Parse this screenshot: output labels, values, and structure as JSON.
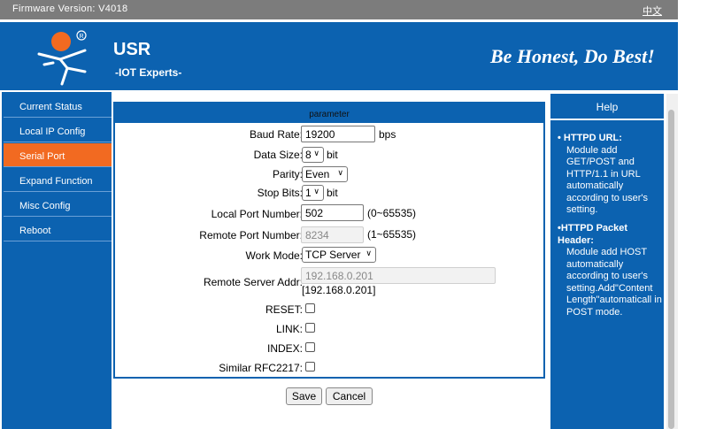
{
  "topbar": {
    "firmware": "Firmware Version:  V4018",
    "language": "中文"
  },
  "banner": {
    "brand": "USR",
    "subtitle": "-IOT Experts-",
    "slogan": "Be Honest, Do Best!"
  },
  "sidebar": {
    "items": [
      {
        "label": "Current Status"
      },
      {
        "label": "Local IP Config"
      },
      {
        "label": "Serial Port",
        "active": true
      },
      {
        "label": "Expand Function"
      },
      {
        "label": "Misc Config"
      },
      {
        "label": "Reboot"
      }
    ]
  },
  "form": {
    "section_title": "parameter",
    "baud_rate": {
      "label": "Baud Rate:",
      "value": "19200",
      "unit": "bps"
    },
    "data_size": {
      "label": "Data Size:",
      "value": "8",
      "unit": "bit"
    },
    "parity": {
      "label": "Parity:",
      "value": "Even"
    },
    "stop_bits": {
      "label": "Stop Bits:",
      "value": "1",
      "unit": "bit"
    },
    "local_port": {
      "label": "Local Port Number:",
      "value": "502",
      "range": "(0~65535)"
    },
    "remote_port": {
      "label": "Remote Port Number:",
      "value": "8234",
      "range": "(1~65535)"
    },
    "work_mode": {
      "label": "Work Mode:",
      "value": "TCP Server"
    },
    "remote_addr": {
      "label": "Remote Server Addr:",
      "value": "192.168.0.201",
      "note": "[192.168.0.201]"
    },
    "reset": {
      "label": "RESET:"
    },
    "link": {
      "label": "LINK:"
    },
    "index": {
      "label": "INDEX:"
    },
    "rfc2217": {
      "label": "Similar RFC2217:"
    },
    "save_label": "Save",
    "cancel_label": "Cancel"
  },
  "help": {
    "title": "Help",
    "items": [
      {
        "title": "HTTPD URL:",
        "body": "Module add GET/POST and HTTP/1.1 in URL automatically according to user's setting."
      },
      {
        "title": "HTTPD Packet Header:",
        "body": "Module add HOST automatically according to user's setting.Add\"Content Length\"automaticall in POST mode."
      }
    ]
  },
  "colors": {
    "primary_blue": "#0c62b0",
    "active_orange": "#f26a21",
    "topbar_gray": "#7c7c7c"
  }
}
